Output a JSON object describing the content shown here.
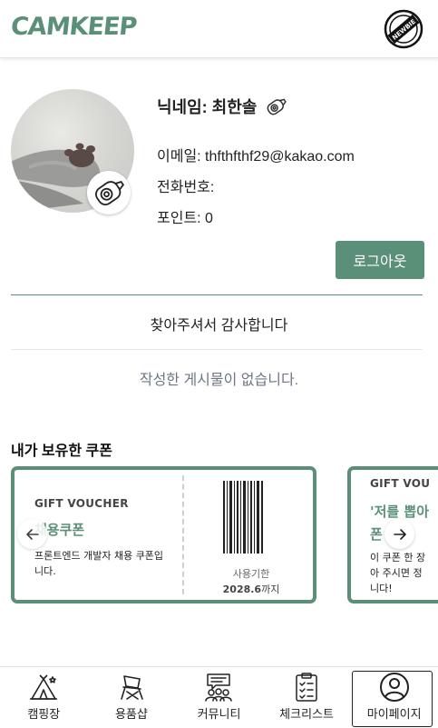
{
  "header": {
    "logo": "CAMKEEP",
    "badge_text": "NEWBIE"
  },
  "profile": {
    "nickname_label": "닉네임: 최한솔",
    "email_label": "이메일: thfthfthf29@kakao.com",
    "phone_label": "전화번호:",
    "points_label": "포인트: 0",
    "logout_label": "로그아웃"
  },
  "thanks_text": "찾아주셔서 감사합니다",
  "posts_empty_text": "작성한 게시물이 없습니다.",
  "coupons": {
    "section_title": "내가 보유한 쿠폰",
    "items": [
      {
        "label": "GIFT VOUCHER",
        "title": "채용쿠폰",
        "description": "프론트엔드 개발자 채용 쿠폰입니다.",
        "expiry_label": "사용기한",
        "expiry_value": "2028.6",
        "expiry_suffix": "까지"
      },
      {
        "label": "GIFT VOU",
        "title_line1": "'저를 뽑아",
        "title_line2": "폰",
        "desc_line1": "이 쿠폰 한 장",
        "desc_line2": "아 주시면 정",
        "desc_line3": "니다!"
      }
    ]
  },
  "bottom_nav": [
    {
      "label": "캠핑장",
      "icon": "tent-icon"
    },
    {
      "label": "용품샵",
      "icon": "camp-chair-icon"
    },
    {
      "label": "커뮤니티",
      "icon": "community-icon"
    },
    {
      "label": "체크리스트",
      "icon": "checklist-icon"
    },
    {
      "label": "마이페이지",
      "icon": "user-icon",
      "active": true
    }
  ],
  "colors": {
    "accent": "#5a8f78",
    "text": "#222222",
    "muted": "#6e7684"
  }
}
